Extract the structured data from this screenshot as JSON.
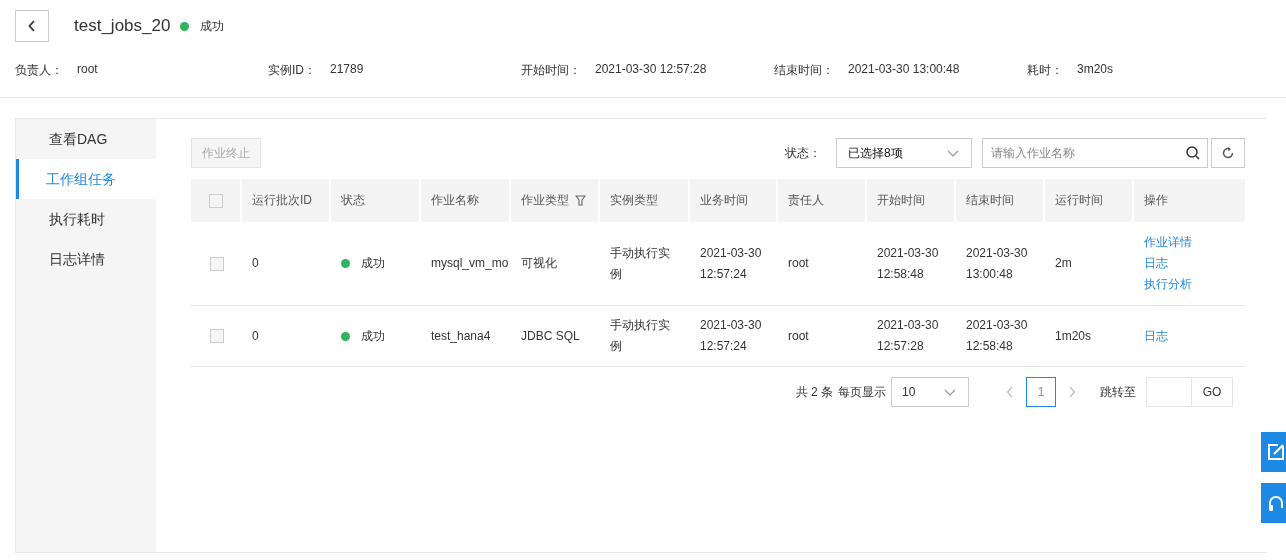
{
  "header": {
    "title": "test_jobs_20",
    "status": {
      "label": "成功",
      "color": "#2db55d"
    }
  },
  "info": [
    {
      "label": "负责人：",
      "value": "root"
    },
    {
      "label": "实例ID：",
      "value": "21789"
    },
    {
      "label": "开始时间：",
      "value": "2021-03-30 12:57:28"
    },
    {
      "label": "结束时间：",
      "value": "2021-03-30 13:00:48"
    },
    {
      "label": "耗时：",
      "value": "3m20s"
    }
  ],
  "sidebar": {
    "items": [
      {
        "label": "查看DAG",
        "selected": false
      },
      {
        "label": "工作组任务",
        "selected": true
      },
      {
        "label": "执行耗时",
        "selected": false
      },
      {
        "label": "日志详情",
        "selected": false
      }
    ]
  },
  "toolbar": {
    "stop_button": {
      "label": "作业终止",
      "disabled": true
    },
    "status_label": "状态：",
    "status_select": "已选择8项",
    "search": {
      "placeholder": "请输入作业名称"
    }
  },
  "table": {
    "select_all_checked": false,
    "columns": [
      {
        "label": "运行批次ID",
        "filter": false
      },
      {
        "label": "状态",
        "filter": false
      },
      {
        "label": "作业名称",
        "filter": false
      },
      {
        "label": "作业类型",
        "filter": true
      },
      {
        "label": "实例类型",
        "filter": false
      },
      {
        "label": "业务时间",
        "filter": false
      },
      {
        "label": "责任人",
        "filter": false
      },
      {
        "label": "开始时间",
        "filter": false
      },
      {
        "label": "结束时间",
        "filter": false
      },
      {
        "label": "运行时间",
        "filter": false
      },
      {
        "label": "操作",
        "filter": false
      }
    ],
    "rows": [
      {
        "checked": false,
        "batch_id": "0",
        "status": {
          "label": "成功",
          "color": "#2db55d"
        },
        "job_name": "mysql_vm_mo",
        "job_type": "可视化",
        "instance_type": "手动执行实例",
        "business_time": "2021-03-30 12:57:24",
        "owner": "root",
        "start_time": "2021-03-30 12:58:48",
        "end_time": "2021-03-30 13:00:48",
        "run_time": "2m",
        "actions": [
          "作业详情",
          "日志",
          "执行分析"
        ]
      },
      {
        "checked": false,
        "batch_id": "0",
        "status": {
          "label": "成功",
          "color": "#2db55d"
        },
        "job_name": "test_hana4",
        "job_type": "JDBC SQL",
        "instance_type": "手动执行实例",
        "business_time": "2021-03-30 12:57:24",
        "owner": "root",
        "start_time": "2021-03-30 12:57:28",
        "end_time": "2021-03-30 12:58:48",
        "run_time": "1m20s",
        "actions": [
          "日志"
        ]
      }
    ]
  },
  "pagination": {
    "total": "共 2 条",
    "page_size_label": "每页显示",
    "page_size": "10",
    "pages": [
      {
        "label": "1",
        "selected": true
      }
    ],
    "jump_label": "跳转至",
    "go": "GO"
  }
}
